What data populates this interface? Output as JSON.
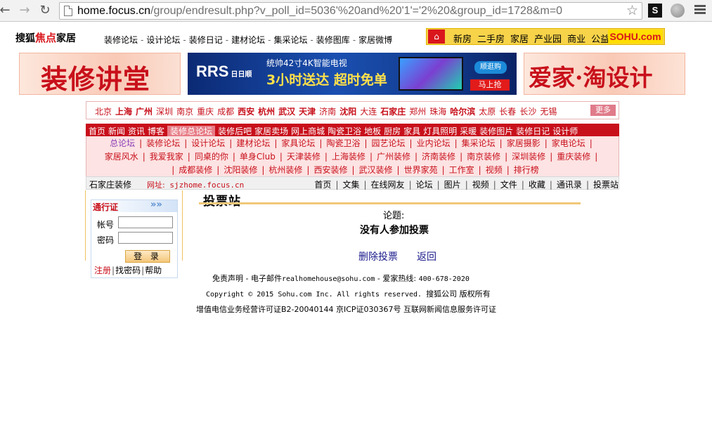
{
  "browser": {
    "url_host": "home.focus.cn",
    "url_path": "/group/endresult.php?v_poll_id=5036'%20and%20'1'='2%20&group_id=1728&m=0",
    "ext_label": "S"
  },
  "topbar": {
    "logo_prefix": "搜狐",
    "logo_mark": "焦点",
    "logo_suffix": "家居",
    "links": [
      "装修论坛",
      "设计论坛",
      "装修日记",
      "建材论坛",
      "集采论坛",
      "装修图库",
      "家居微博"
    ],
    "sohu_links": [
      "新房",
      "二手房",
      "家居",
      "产业园",
      "商业",
      "公益"
    ],
    "sohu_logo": "SOHU.com",
    "home_icon": "home-icon"
  },
  "banners": {
    "left": "装修讲堂",
    "mid_brand": "RRS",
    "mid_brand_sub": "日日顺",
    "mid_line1": "统帅42寸4K智能电视",
    "mid_line2": "3小时送达 超时免单",
    "mid_tag": "顺逛购",
    "mid_button": "马上抢",
    "right": "爱家·淘设计"
  },
  "citynav": {
    "cities": [
      {
        "name": "北京",
        "bold": false
      },
      {
        "name": "上海",
        "bold": true
      },
      {
        "name": "广州",
        "bold": true
      },
      {
        "name": "深圳",
        "bold": false
      },
      {
        "name": "南京",
        "bold": false
      },
      {
        "name": "重庆",
        "bold": false
      },
      {
        "name": "成都",
        "bold": false
      },
      {
        "name": "西安",
        "bold": true
      },
      {
        "name": "杭州",
        "bold": true
      },
      {
        "name": "武汉",
        "bold": true
      },
      {
        "name": "天津",
        "bold": true
      },
      {
        "name": "济南",
        "bold": false
      },
      {
        "name": "沈阳",
        "bold": true
      },
      {
        "name": "大连",
        "bold": false
      },
      {
        "name": "石家庄",
        "bold": true
      },
      {
        "name": "郑州",
        "bold": false
      },
      {
        "name": "珠海",
        "bold": false
      },
      {
        "name": "哈尔滨",
        "bold": true
      },
      {
        "name": "太原",
        "bold": false
      },
      {
        "name": "长春",
        "bold": false
      },
      {
        "name": "长沙",
        "bold": false
      },
      {
        "name": "无锡",
        "bold": false
      }
    ],
    "more": "更多"
  },
  "rednav": {
    "items": [
      "首页",
      "新闻",
      "资讯",
      "博客",
      "装修总论坛",
      "装修后吧",
      "家居卖场",
      "网上商城",
      "陶瓷卫浴",
      "地板",
      "厨房",
      "家具",
      "灯具照明",
      "采暖",
      "装修图片",
      "装修日记",
      "设计师"
    ],
    "active": "装修总论坛"
  },
  "subnav": {
    "row1": [
      "总论坛",
      "装修论坛",
      "设计论坛",
      "建材论坛",
      "家具论坛",
      "陶瓷卫浴",
      "园艺论坛",
      "业内论坛",
      "集采论坛",
      "家居摄影",
      "家电论坛"
    ],
    "row2": [
      "家居风水",
      "我爱我家",
      "同桌的你",
      "单身Club",
      "天津装修",
      "上海装修",
      "广州装修",
      "济南装修",
      "南京装修",
      "深圳装修",
      "重庆装修"
    ],
    "row3": [
      "成都装修",
      "沈阳装修",
      "杭州装修",
      "西安装修",
      "武汉装修",
      "世界家苑",
      "工作室",
      "视频",
      "排行榜"
    ]
  },
  "sitebar": {
    "name": "石家庄装修",
    "url_label": "网址:",
    "url": "sjzhome.focus.cn",
    "links": [
      "首页",
      "文集",
      "在线网友",
      "论坛",
      "图片",
      "视频",
      "文件",
      "收藏",
      "通讯录",
      "投票站"
    ]
  },
  "login": {
    "title": "通行证",
    "arrows": "»»",
    "account_label": "帐号",
    "password_label": "密码",
    "submit": "登 录",
    "register": "注册",
    "find_password": "找密码",
    "help": "帮助"
  },
  "main": {
    "title": "投票站",
    "topic_label": "论题:",
    "result": "没有人参加投票",
    "delete_vote": "删除投票",
    "back": "返回"
  },
  "footer": {
    "disclaimer": "免责声明",
    "email_label": "电子邮件",
    "email": "realhomehouse@sohu.com",
    "hotline_label": "爱家热线:",
    "hotline": "400-678-2020",
    "copyright": "Copyright © 2015 Sohu.com Inc. All rights reserved.",
    "company": "搜狐公司 版权所有",
    "license": "增值电信业务经营许可证B2-20040144 京ICP证030367号 互联网新闻信息服务许可证"
  }
}
